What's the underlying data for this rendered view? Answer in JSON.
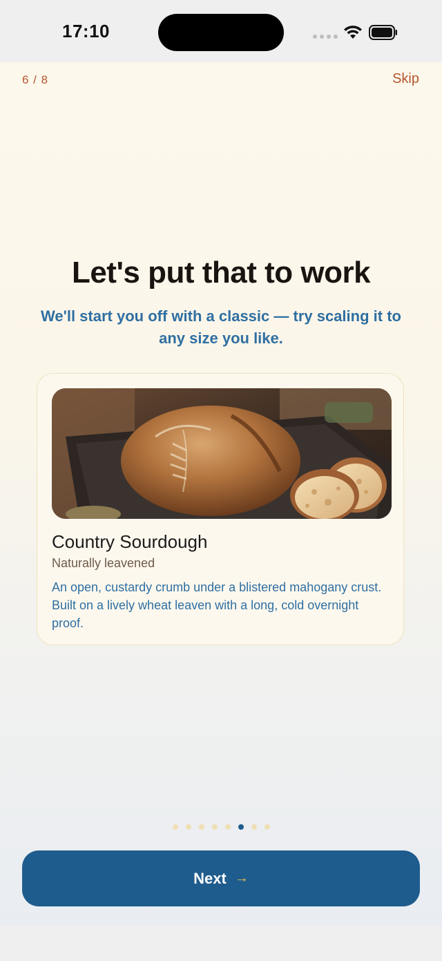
{
  "status_bar": {
    "time": "17:10"
  },
  "header": {
    "step": "6 / 8",
    "skip_label": "Skip"
  },
  "main": {
    "headline": "Let's put that to work",
    "subhead": "We'll start you off with a classic — try scaling it to any size you like."
  },
  "recipe_card": {
    "title": "Country Sourdough",
    "tag": "Naturally leavened",
    "description": "An open, custardy crumb under a blistered mahogany crust. Built on a lively wheat leaven with a long, cold overnight proof.",
    "image_icon": "sourdough-bread-photo"
  },
  "pagination": {
    "total": 8,
    "current": 6
  },
  "footer": {
    "next_label": "Next",
    "next_icon": "arrow-right-icon"
  },
  "colors": {
    "accent": "#1f5c8e",
    "warm": "#b4562e",
    "link_blue": "#2f6fa1",
    "dot_inactive": "#f0dfb6"
  }
}
